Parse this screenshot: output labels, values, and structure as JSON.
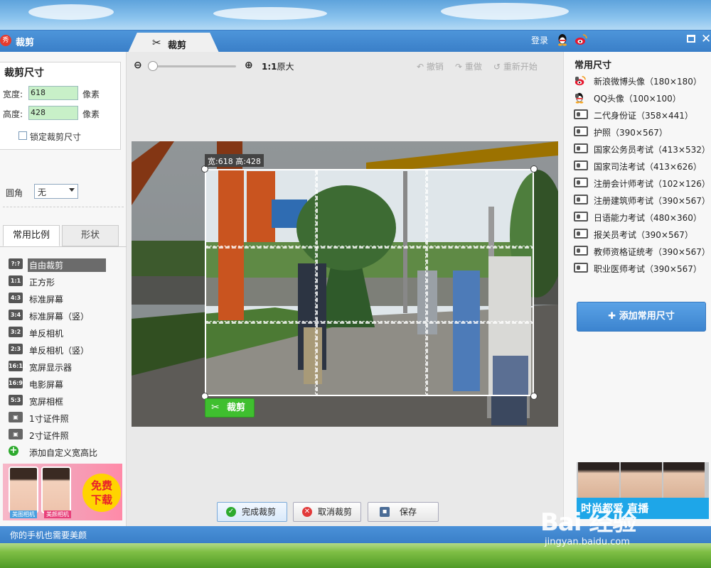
{
  "window": {
    "title": "裁剪",
    "active_tab": "裁剪",
    "login_label": "登录"
  },
  "left": {
    "size_title": "裁剪尺寸",
    "width_label": "宽度:",
    "width_value": "618",
    "height_label": "高度:",
    "height_value": "428",
    "unit": "像素",
    "lock_label": "锁定裁剪尺寸",
    "corner_label": "圆角",
    "corner_value": "无",
    "tabs": [
      "常用比例",
      "形状"
    ],
    "ratios": [
      {
        "icon": "?:?",
        "label": "自由裁剪",
        "selected": true
      },
      {
        "icon": "1:1",
        "label": "正方形"
      },
      {
        "icon": "4:3",
        "label": "标准屏幕"
      },
      {
        "icon": "3:4",
        "label": "标准屏幕（竖）"
      },
      {
        "icon": "3:2",
        "label": "单反相机"
      },
      {
        "icon": "2:3",
        "label": "单反相机（竖）"
      },
      {
        "icon": "16:10",
        "label": "宽屏显示器"
      },
      {
        "icon": "16:9",
        "label": "电影屏幕"
      },
      {
        "icon": "5:3",
        "label": "宽屏相框"
      },
      {
        "icon": "id-card",
        "label": "1寸证件照"
      },
      {
        "icon": "id-card",
        "label": "2寸证件照"
      },
      {
        "icon": "+",
        "label": "添加自定义宽高比"
      }
    ],
    "ad_badge": "免费下载",
    "ad_tags": [
      "美图相机",
      "美颜相机"
    ]
  },
  "center": {
    "zoom_level": 0.0,
    "original_ratio": "1:1",
    "original_label": "原大",
    "undo_label": "撤销",
    "redo_label": "重做",
    "restart_label": "重新开始",
    "crop_dimensions": "宽:618 高:428",
    "crop_button": "裁剪",
    "finish_button": "完成裁剪",
    "cancel_button": "取消裁剪",
    "save_button": "保存"
  },
  "right": {
    "title": "常用尺寸",
    "presets": [
      {
        "icon": "weibo-icon",
        "label": "新浪微博头像（180×180）"
      },
      {
        "icon": "qq-icon",
        "label": "QQ头像（100×100）"
      },
      {
        "icon": "id-card-icon",
        "label": "二代身份证（358×441）"
      },
      {
        "icon": "id-card-icon",
        "label": "护照（390×567）"
      },
      {
        "icon": "id-card-icon",
        "label": "国家公务员考试（413×532）"
      },
      {
        "icon": "id-card-icon",
        "label": "国家司法考试（413×626）"
      },
      {
        "icon": "id-card-icon",
        "label": "注册会计师考试（102×126）"
      },
      {
        "icon": "id-card-icon",
        "label": "注册建筑师考试（390×567）"
      },
      {
        "icon": "id-card-icon",
        "label": "日语能力考试（480×360）"
      },
      {
        "icon": "id-card-icon",
        "label": "报关员考试（390×567）"
      },
      {
        "icon": "id-card-icon",
        "label": "教师资格证统考（390×567）"
      },
      {
        "icon": "id-card-icon",
        "label": "职业医师考试（390×567）"
      }
    ],
    "add_button": "添加常用尺寸",
    "ad_banner": "时尚都爱 直播"
  },
  "status": {
    "text": "你的手机也需要美颜"
  },
  "watermark": {
    "brand": "Bai 经验",
    "url": "jingyan.baidu.com"
  },
  "colors": {
    "titlebar": "#3a7fc8",
    "accent_green": "#3fbf2f",
    "field_green": "#c8f0c8",
    "button_blue": "#4a91d8"
  }
}
